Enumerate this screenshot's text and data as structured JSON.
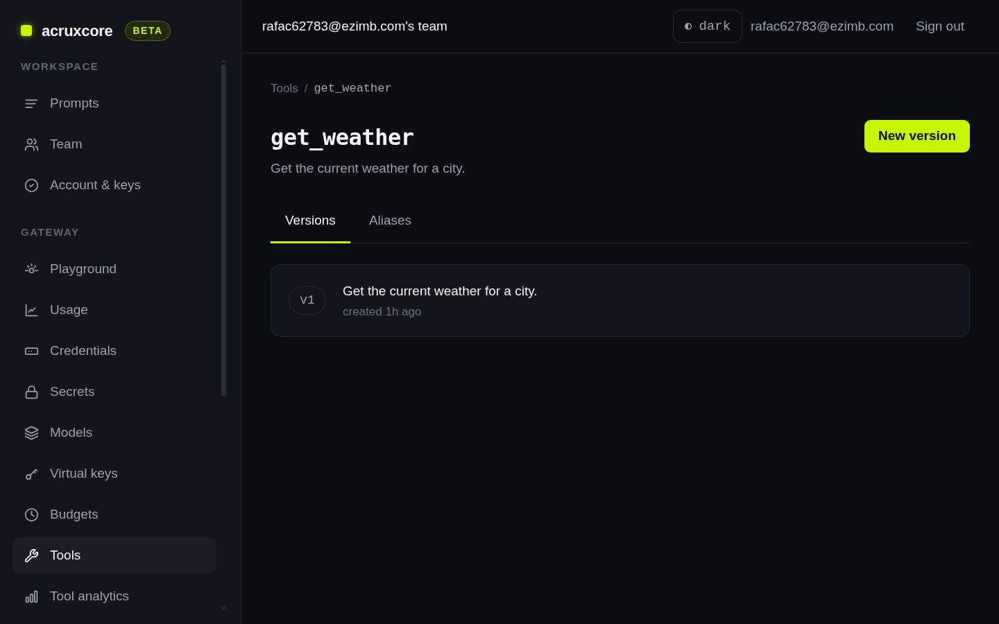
{
  "brand": {
    "name": "acruxcore",
    "badge": "BETA"
  },
  "sidebar": {
    "sections": [
      {
        "heading": "WORKSPACE",
        "items": [
          {
            "label": "Prompts",
            "selected": false
          },
          {
            "label": "Team",
            "selected": false
          },
          {
            "label": "Account & keys",
            "selected": false
          }
        ]
      },
      {
        "heading": "GATEWAY",
        "items": [
          {
            "label": "Playground",
            "selected": false
          },
          {
            "label": "Usage",
            "selected": false
          },
          {
            "label": "Credentials",
            "selected": false
          },
          {
            "label": "Secrets",
            "selected": false
          },
          {
            "label": "Models",
            "selected": false
          },
          {
            "label": "Virtual keys",
            "selected": false
          },
          {
            "label": "Budgets",
            "selected": false
          },
          {
            "label": "Tools",
            "selected": true
          },
          {
            "label": "Tool analytics",
            "selected": false
          }
        ]
      }
    ]
  },
  "header": {
    "team": "rafac62783@ezimb.com's team",
    "theme_toggle": "dark",
    "user_email": "rafac62783@ezimb.com",
    "sign_out": "Sign out"
  },
  "page": {
    "breadcrumb": {
      "items": [
        "Tools",
        "get_weather"
      ],
      "separator": "/"
    },
    "title": "get_weather",
    "description": "Get the current weather for a city.",
    "primary_button": "New version",
    "tabs": [
      {
        "label": "Versions",
        "selected": true
      },
      {
        "label": "Aliases",
        "selected": false
      }
    ],
    "versions": [
      {
        "tag": "v1",
        "description": "Get the current weather for a city.",
        "created": "created 1h ago"
      }
    ]
  }
}
